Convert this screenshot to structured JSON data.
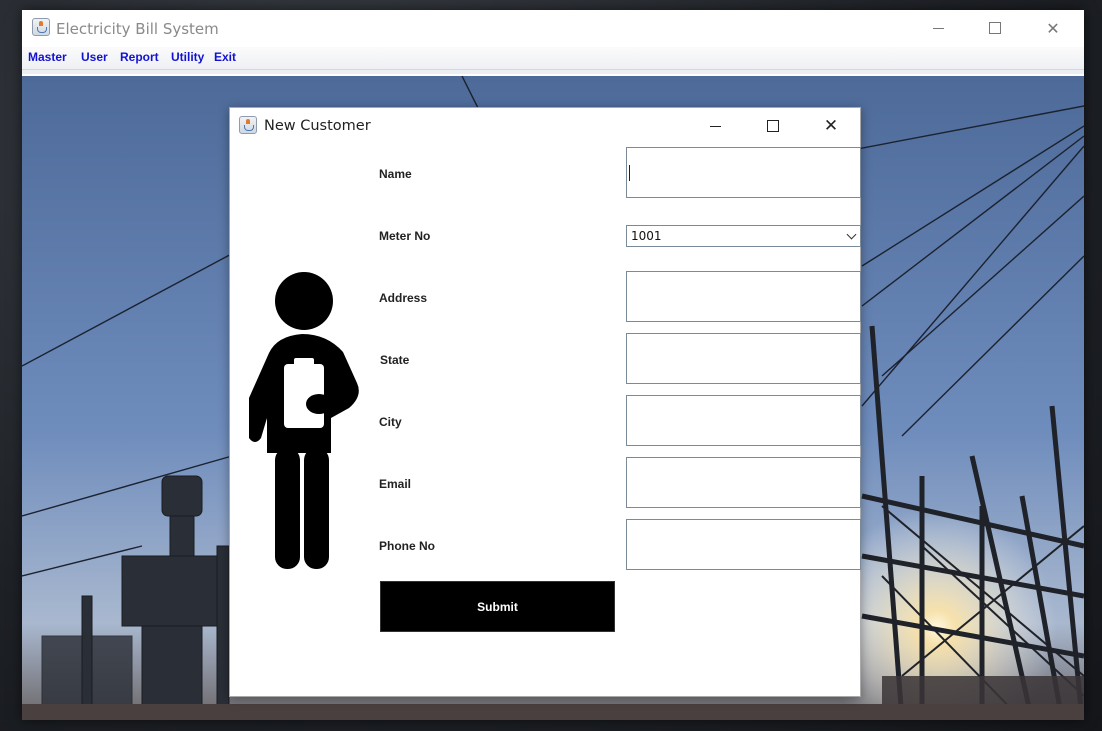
{
  "main_window": {
    "title": "Electricity Bill System",
    "menu": [
      "Master",
      "User",
      "Report",
      "Utility",
      "Exit"
    ]
  },
  "dialog": {
    "title": "New Customer",
    "fields": {
      "name": {
        "label": "Name",
        "value": ""
      },
      "meter_no": {
        "label": "Meter No",
        "value": "1001"
      },
      "address": {
        "label": "Address",
        "value": ""
      },
      "state": {
        "label": "State",
        "value": ""
      },
      "city": {
        "label": "City",
        "value": ""
      },
      "email": {
        "label": "Email",
        "value": ""
      },
      "phone": {
        "label": "Phone No",
        "value": ""
      }
    },
    "submit_label": "Submit"
  },
  "icons": {
    "app": "java-cup-icon",
    "illustration": "person-with-clipboard-icon"
  },
  "colors": {
    "menu_text": "#1212d4",
    "submit_bg": "#000000",
    "submit_text": "#ffffff"
  }
}
